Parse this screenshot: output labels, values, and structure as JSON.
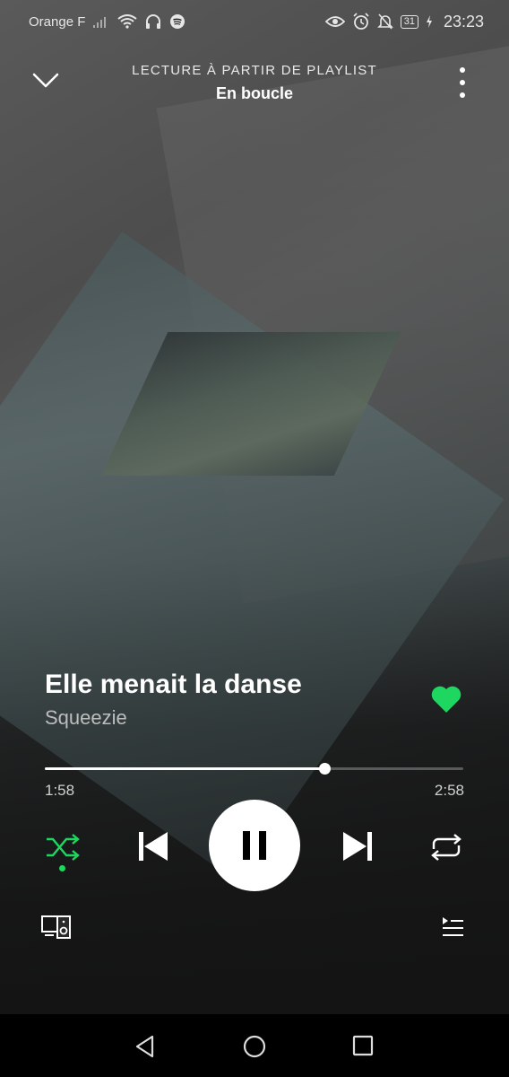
{
  "status_bar": {
    "carrier": "Orange F",
    "battery": "31",
    "time": "23:23"
  },
  "header": {
    "context_label": "LECTURE À PARTIR DE PLAYLIST",
    "playlist_name": "En boucle"
  },
  "track": {
    "title": "Elle menait la danse",
    "artist": "Squeezie",
    "liked": true
  },
  "playback": {
    "elapsed": "1:58",
    "duration": "2:58",
    "progress_fraction": 0.669,
    "shuffle_on": true,
    "state": "playing"
  },
  "icons": {
    "collapse": "chevron-down-icon",
    "more": "more-vertical-icon",
    "like": "heart-icon",
    "shuffle": "shuffle-icon",
    "previous": "skip-previous-icon",
    "pause": "pause-icon",
    "next": "skip-next-icon",
    "repeat": "repeat-icon",
    "devices": "connect-devices-icon",
    "queue": "queue-icon"
  },
  "colors": {
    "accent": "#1ed760",
    "text_primary": "#ffffff",
    "text_secondary": "#bdbdbd"
  }
}
